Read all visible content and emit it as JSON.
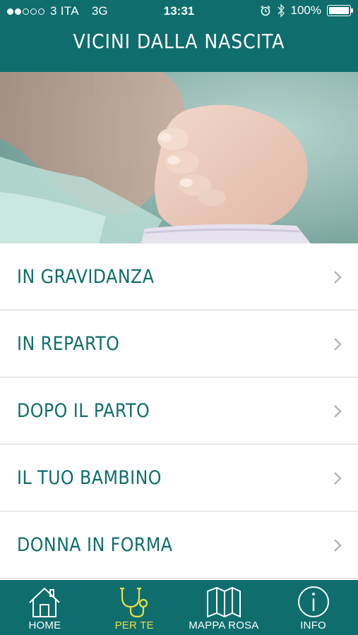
{
  "status_bar": {
    "signal_dots_filled": 2,
    "signal_dots_total": 5,
    "carrier": "3 ITA",
    "network": "3G",
    "time": "13:31",
    "battery_percent": "100%",
    "battery_level": 1.0,
    "icons": [
      "alarm-icon",
      "bluetooth-icon",
      "battery-icon"
    ]
  },
  "header": {
    "title": "VICINI DALLA NASCITA"
  },
  "hero": {
    "image_description_icon": "baby-hand-photo"
  },
  "menu": {
    "items": [
      {
        "label": "IN GRAVIDANZA"
      },
      {
        "label": "IN REPARTO"
      },
      {
        "label": "DOPO IL PARTO"
      },
      {
        "label": "IL TUO BAMBINO"
      },
      {
        "label": "DONNA IN FORMA"
      }
    ]
  },
  "tabbar": {
    "tabs": [
      {
        "label": "HOME",
        "icon": "house-icon",
        "active": false
      },
      {
        "label": "PER TE",
        "icon": "stethoscope-icon",
        "active": true
      },
      {
        "label": "MAPPA ROSA",
        "icon": "map-icon",
        "active": false
      },
      {
        "label": "INFO",
        "icon": "info-icon",
        "active": false
      }
    ]
  },
  "colors": {
    "primary": "#0f6d6d",
    "active_tab": "#e8e04b",
    "divider": "#d6d6d6",
    "chevron": "#b5b5b5"
  }
}
